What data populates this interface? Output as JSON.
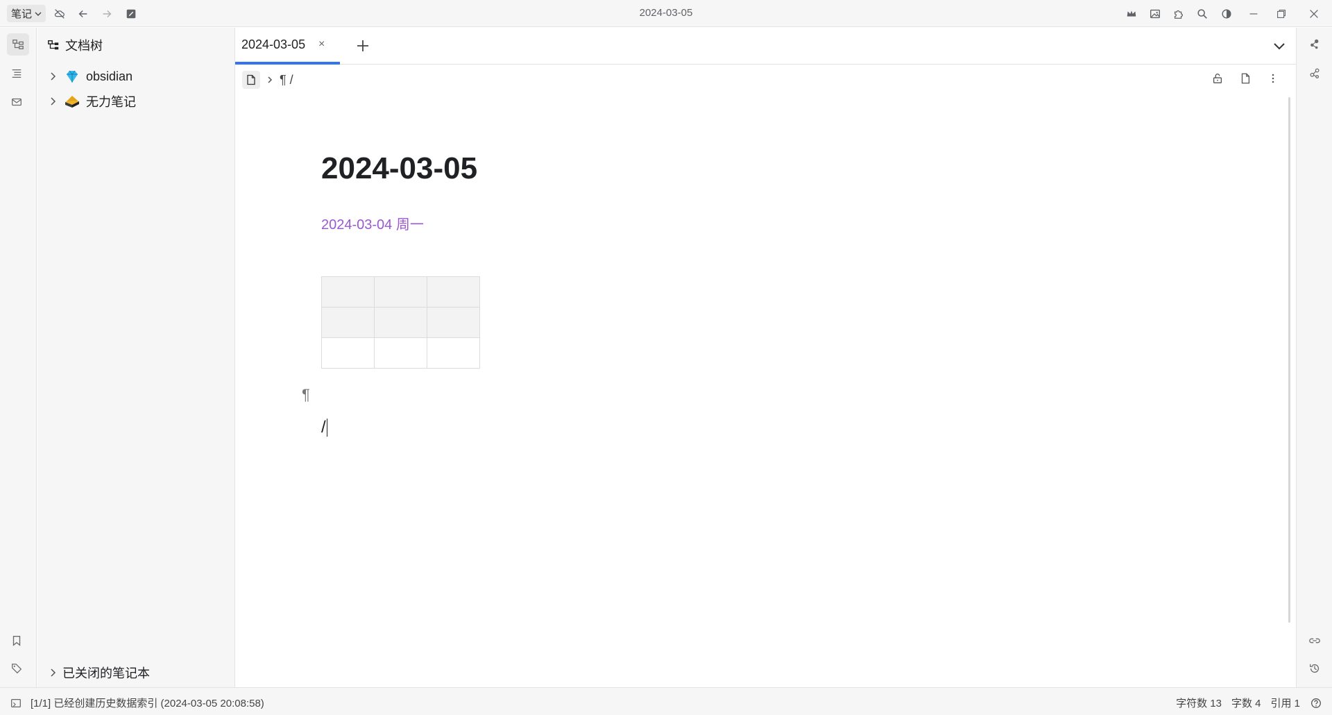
{
  "titlebar": {
    "workspace_label": "笔记",
    "window_title": "2024-03-05"
  },
  "left_dock": {
    "icons": [
      "file-tree-icon",
      "outline-icon",
      "inbox-icon"
    ],
    "bottom_icons": [
      "bookmark-icon",
      "tag-icon"
    ]
  },
  "filetree": {
    "header": "文档树",
    "notebooks": [
      {
        "name": "obsidian",
        "icon": "gem-icon"
      },
      {
        "name": "无力笔记",
        "icon": "book-icon"
      }
    ],
    "closed_label": "已关闭的笔记本"
  },
  "tabs": [
    {
      "label": "2024-03-05",
      "close": "×"
    }
  ],
  "breadcrumb": {
    "path_text": "¶ /"
  },
  "document": {
    "title": "2024-03-05",
    "date_link": "2024-03-04 周一",
    "para_mark": "¶",
    "current_line": "/"
  },
  "statusbar": {
    "message": "[1/1] 已经创建历史数据索引 (2024-03-05 20:08:58)",
    "char_count_label": "字符数",
    "char_count": "13",
    "word_count_label": "字数",
    "word_count": "4",
    "ref_label": "引用",
    "ref_count": "1"
  },
  "colors": {
    "accent": "#3574f0",
    "date_link": "#9b59d0",
    "panel_bg": "#f6f6f6"
  }
}
